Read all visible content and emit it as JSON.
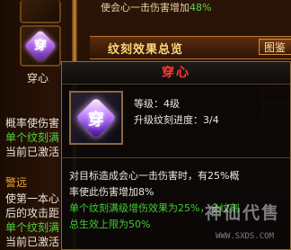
{
  "background": {
    "top_effect": {
      "text": "使会心一击伤害增加",
      "value": "48%"
    },
    "slot": {
      "label": "穿心",
      "rune": "穿"
    },
    "panel_title": "纹刻效果总览",
    "panel_button": "图鉴",
    "left_lines": [
      {
        "text": "概率使伤害",
        "style": "white"
      },
      {
        "text": "单个纹刻满",
        "style": "green"
      },
      {
        "text": "当前已激活",
        "style": "white"
      },
      {
        "text": "警远",
        "style": "orange"
      },
      {
        "text": "使第一本心",
        "style": "white"
      },
      {
        "text": "后的攻击距",
        "style": "white"
      },
      {
        "text": "单个纹刻满",
        "style": "green"
      },
      {
        "text": "当前已激活",
        "style": "white"
      }
    ]
  },
  "tooltip": {
    "title": "穿心",
    "icon": "pierce-heart-gem-icon",
    "rune_char": "穿",
    "level": "等级：4级",
    "upgrade_progress": "升级纹刻进度：3/4",
    "description_lines": [
      {
        "text": "对目标造成会心一击伤害时，有25%概",
        "style": "white"
      },
      {
        "text": "率使此伤害增加8%",
        "style": "white"
      },
      {
        "text": "单个纹刻满级增伤效果为25%，全纹刻",
        "style": "green"
      },
      {
        "text": "总生效上限为50%",
        "style": "green"
      }
    ]
  },
  "watermark": {
    "main": "神仙代售",
    "sub": "WWW.SXDS.COM"
  }
}
